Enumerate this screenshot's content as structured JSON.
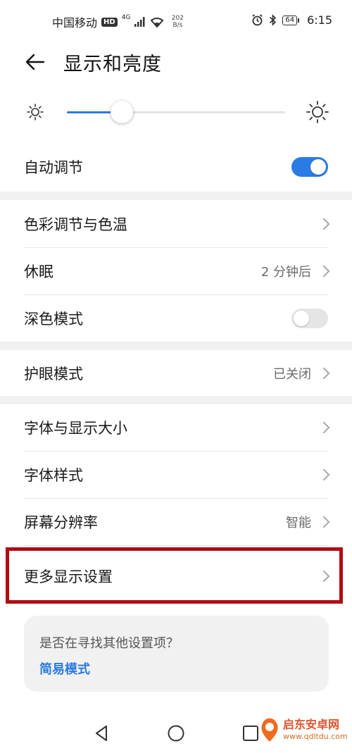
{
  "status_bar": {
    "carrier": "中国移动",
    "hd_label": "HD",
    "network_type": "4G",
    "speed_value": "202",
    "speed_unit": "B/s",
    "battery": "64",
    "time": "6:15",
    "icons": [
      "signal-icon",
      "wifi-icon",
      "alarm-icon",
      "bluetooth-icon",
      "battery-icon"
    ]
  },
  "header": {
    "title": "显示和亮度"
  },
  "brightness": {
    "level_percent": 25,
    "accent_color": "#2b7be4"
  },
  "auto_adjust": {
    "label": "自动调节",
    "enabled": true
  },
  "group1": [
    {
      "label": "色彩调节与色温",
      "value": ""
    },
    {
      "label": "休眠",
      "value": "2 分钟后"
    },
    {
      "label": "深色模式",
      "toggle": false
    }
  ],
  "eye_care": {
    "label": "护眼模式",
    "value": "已关闭"
  },
  "group3": [
    {
      "label": "字体与显示大小",
      "value": ""
    },
    {
      "label": "字体样式",
      "value": ""
    },
    {
      "label": "屏幕分辨率",
      "value": "智能"
    },
    {
      "label": "更多显示设置",
      "value": ""
    }
  ],
  "suggestion_card": {
    "question": "是否在寻找其他设置项？",
    "link": "简易模式"
  },
  "navigation": {
    "buttons": [
      "back-icon",
      "home-icon",
      "recents-icon"
    ]
  },
  "watermark": {
    "name": "启东安卓网",
    "url": "www.qdltdu.com"
  },
  "colors": {
    "highlight": "#b00c12",
    "accent": "#2b7be4"
  }
}
